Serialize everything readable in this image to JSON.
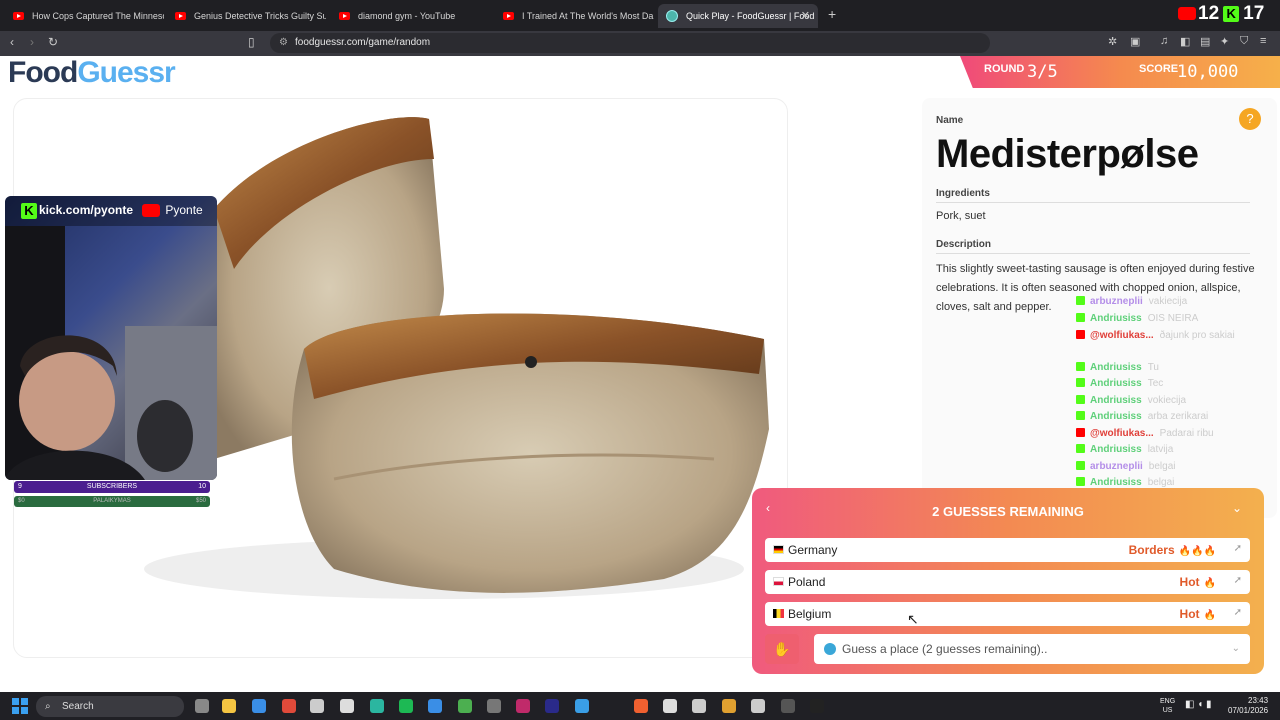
{
  "browser": {
    "tabs": [
      {
        "label": "How Cops Captured The Minnesota",
        "kind": "youtube"
      },
      {
        "label": "Genius Detective Tricks Guilty Suspec",
        "kind": "youtube"
      },
      {
        "label": "diamond gym - YouTube",
        "kind": "youtube"
      },
      {
        "label": "I Trained At The World's Most Dange",
        "kind": "youtube"
      },
      {
        "label": "Quick Play - FoodGuessr | Food",
        "kind": "site"
      }
    ],
    "url": "foodguessr.com/game/random",
    "ext_counts": {
      "youtube": "12",
      "kick": "17"
    }
  },
  "header": {
    "logo_food": "Food",
    "logo_guessr": "Guessr",
    "round_label": "ROUND",
    "round_value": "3/5",
    "score_label": "SCORE",
    "score_value": "10,000"
  },
  "overlay": {
    "kick_handle": "kick.com/pyonte",
    "youtube_handle": "Pyonte",
    "subs_label": "SUBSCRIBERS",
    "subs_left": "9",
    "subs_right": "10",
    "donation_label": "PALAIKYMAS",
    "donation_left": "$0",
    "donation_right": "$50"
  },
  "info": {
    "name_label": "Name",
    "name": "Medisterpølse",
    "ingredients_label": "Ingredients",
    "ingredients": "Pork, suet",
    "description_label": "Description",
    "description": "This slightly sweet-tasting sausage is often enjoyed during festive celebrations. It is often seasoned with chopped onion, allspice, cloves, salt and pepper."
  },
  "chat": [
    {
      "user": "arbuzneplii",
      "msg": "vakiecija",
      "platform": "kick",
      "color": "#b48ee8"
    },
    {
      "user": "Andriusiss",
      "msg": "OIS NEIRA",
      "platform": "kick",
      "color": "#5fd07a"
    },
    {
      "user": "@wolfiukas...",
      "msg": "ðajunk pro sakiai",
      "platform": "youtube",
      "color": "#e0403a"
    },
    {
      "user": "Andriusiss",
      "msg": "Tu",
      "platform": "kick",
      "color": "#5fd07a"
    },
    {
      "user": "Andriusiss",
      "msg": "Tec",
      "platform": "kick",
      "color": "#5fd07a"
    },
    {
      "user": "Andriusiss",
      "msg": "vokiecija",
      "platform": "kick",
      "color": "#5fd07a"
    },
    {
      "user": "Andriusiss",
      "msg": "arba zerikarai",
      "platform": "kick",
      "color": "#5fd07a"
    },
    {
      "user": "@wolfiukas...",
      "msg": "Padarai ribu",
      "platform": "youtube",
      "color": "#e0403a"
    },
    {
      "user": "Andriusiss",
      "msg": "latvija",
      "platform": "kick",
      "color": "#5fd07a"
    },
    {
      "user": "arbuzneplii",
      "msg": "belgai",
      "platform": "kick",
      "color": "#b48ee8"
    },
    {
      "user": "Andriusiss",
      "msg": "belgai",
      "platform": "kick",
      "color": "#5fd07a"
    }
  ],
  "guess": {
    "title": "2 GUESSES REMAINING",
    "rows": [
      {
        "country": "Germany",
        "result": "Borders",
        "flames": "🔥🔥🔥",
        "colors": [
          "#000",
          "#d00",
          "#fc0"
        ]
      },
      {
        "country": "Poland",
        "result": "Hot",
        "flames": "🔥",
        "colors": [
          "#fff",
          "#dc143c"
        ]
      },
      {
        "country": "Belgium",
        "result": "Hot",
        "flames": "🔥",
        "colors": [
          "#000",
          "#fdda24",
          "#ef3340"
        ]
      }
    ],
    "placeholder": "Guess a place (2 guesses remaining).."
  },
  "taskbar": {
    "search": "Search",
    "lang1": "ENG",
    "lang2": "US",
    "time": "23:43",
    "date": "07/01/2026"
  }
}
